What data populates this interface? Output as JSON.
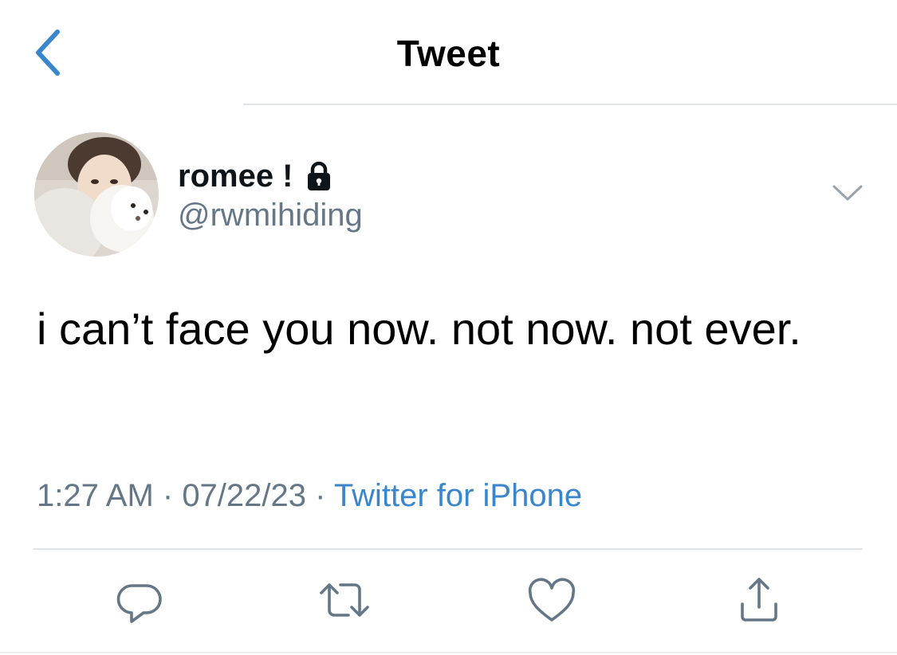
{
  "nav": {
    "title": "Tweet",
    "back_icon": "chevron-left-icon"
  },
  "tweet": {
    "author": {
      "display_name": "romee !",
      "username": "@rwmihiding",
      "protected_icon": "lock-icon"
    },
    "text": "i can’t face you now. not now. not ever.",
    "time": "1:27 AM",
    "separator": " · ",
    "date": "07/22/23",
    "source": "Twitter for iPhone",
    "more_icon": "chevron-down-icon"
  },
  "actions": [
    {
      "name": "reply",
      "icon": "reply-icon"
    },
    {
      "name": "retweet",
      "icon": "retweet-icon"
    },
    {
      "name": "like",
      "icon": "heart-icon"
    },
    {
      "name": "share",
      "icon": "share-icon"
    }
  ],
  "colors": {
    "accent": "#3a86cc",
    "secondary_text": "#657786",
    "icon_gray": "#657786",
    "divider": "#e1e4e6"
  }
}
